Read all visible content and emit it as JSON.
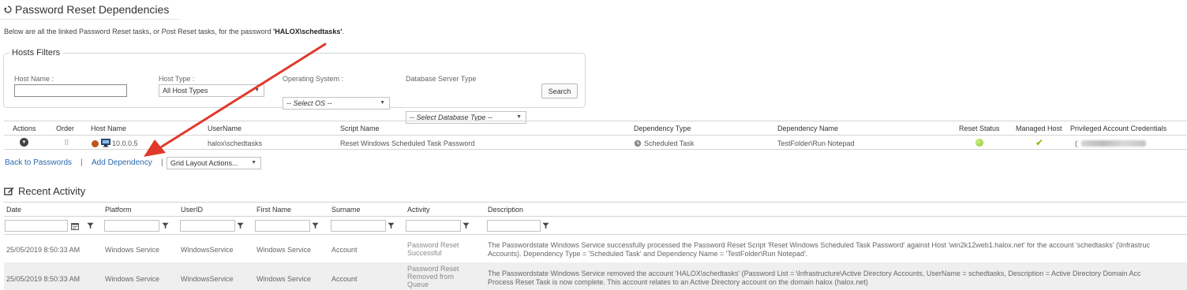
{
  "page": {
    "title": "Password Reset Dependencies",
    "intro_prefix": "Below are all the linked Password Reset tasks, or Post Reset tasks, for the password ",
    "intro_password": "'HALOX\\schedtasks'",
    "intro_suffix": "."
  },
  "filters": {
    "legend": "Hosts Filters",
    "host_name_label": "Host Name :",
    "host_name_value": "",
    "host_type_label": "Host Type :",
    "host_type_value": "All Host Types",
    "os_label": "Operating System :",
    "os_value": "-- Select OS --",
    "db_label": "Database Server Type",
    "db_value": "-- Select Database Type --",
    "search_label": "Search"
  },
  "dependencies": {
    "columns": [
      "Actions",
      "Order",
      "Host Name",
      "UserName",
      "Script Name",
      "Dependency Type",
      "Dependency Name",
      "Reset Status",
      "Managed Host",
      "Privileged Account Credentials"
    ],
    "row": {
      "order_glyph": "⠿",
      "host": "10.0.0.5",
      "username": "halox\\schedtasks",
      "script": "Reset Windows Scheduled Task Password",
      "dep_type": "Scheduled Task",
      "dep_name": "TestFolder\\Run Notepad",
      "credentials_prefix": "("
    }
  },
  "links": {
    "back": "Back to Passwords",
    "add": "Add Dependency",
    "separator": "|",
    "grid_layout": "Grid Layout Actions..."
  },
  "recent": {
    "title": "Recent Activity",
    "columns": [
      "Date",
      "Platform",
      "UserID",
      "First Name",
      "Surname",
      "Activity",
      "Description"
    ],
    "rows": [
      {
        "date": "25/05/2019 8:50:33 AM",
        "platform": "Windows Service",
        "userid": "WindowsService",
        "first": "Windows Service",
        "surname": "Account",
        "activity1": "Password Reset",
        "activity2": "Successful",
        "activity3": "",
        "desc1": "The Passwordstate Windows Service successfully processed the Password Reset Script 'Reset Windows Scheduled Task Password' against Host 'win2k12web1.halox.net' for the account 'schedtasks' (\\Infrastruc",
        "desc2": "Accounts). Dependency Type = 'Scheduled Task' and Dependency Name = 'TestFolder\\Run Notepad'."
      },
      {
        "date": "25/05/2019 8:50:33 AM",
        "platform": "Windows Service",
        "userid": "WindowsService",
        "first": "Windows Service",
        "surname": "Account",
        "activity1": "Password Reset",
        "activity2": "Removed from",
        "activity3": "Queue",
        "desc1": "The Passwordstate Windows Service removed the account 'HALOX\\schedtasks' (Password List = \\Infrastructure\\Active Directory Accounts, UserName = schedtasks, Description = Active Directory Domain Acc",
        "desc2": "Process Reset Task is now complete. This account relates to an Active Directory account on the domain halox (halox.net)"
      }
    ]
  },
  "colors": {
    "link": "#2a6ab1",
    "annotation_arrow": "#e0392b",
    "reset_status": "#8cc63f",
    "managed_check": "#7ab800",
    "host_status": "#c0541e",
    "alt_row": "#efefef"
  }
}
